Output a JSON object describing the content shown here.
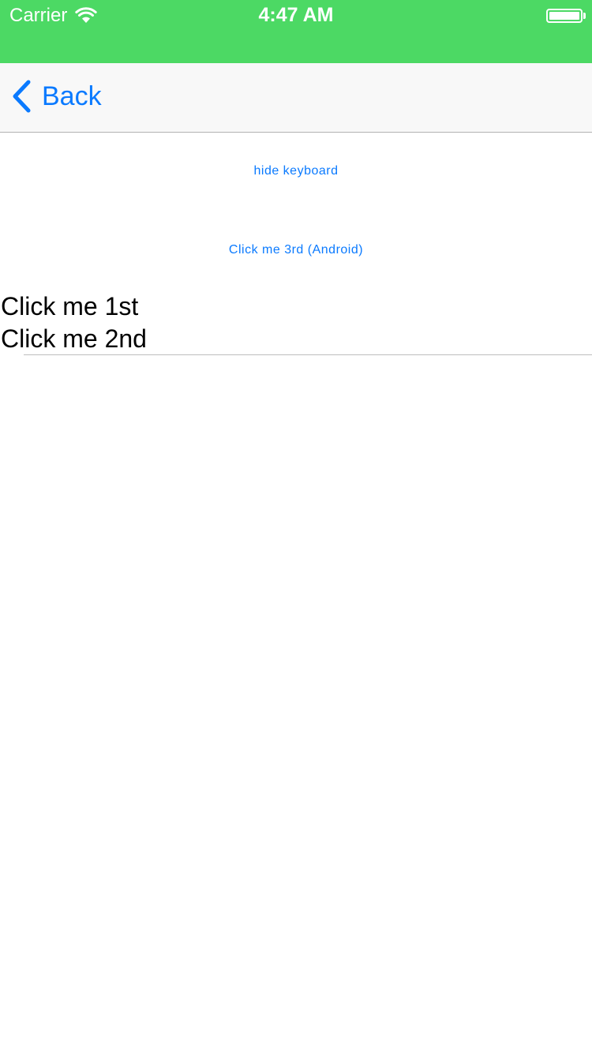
{
  "status_bar": {
    "carrier": "Carrier",
    "time": "4:47 AM",
    "wifi_icon": "wifi-icon",
    "battery_icon": "battery-icon",
    "color": "#4cd964"
  },
  "nav_bar": {
    "back_label": "Back",
    "back_icon": "chevron-left-icon",
    "accent": "#0a7aff"
  },
  "content": {
    "hide_keyboard_label": "hide keyboard",
    "click_third_label": "Click me 3rd (Android)",
    "click_first_text": "Click me 1st",
    "click_second_value": "Click me 2nd"
  }
}
